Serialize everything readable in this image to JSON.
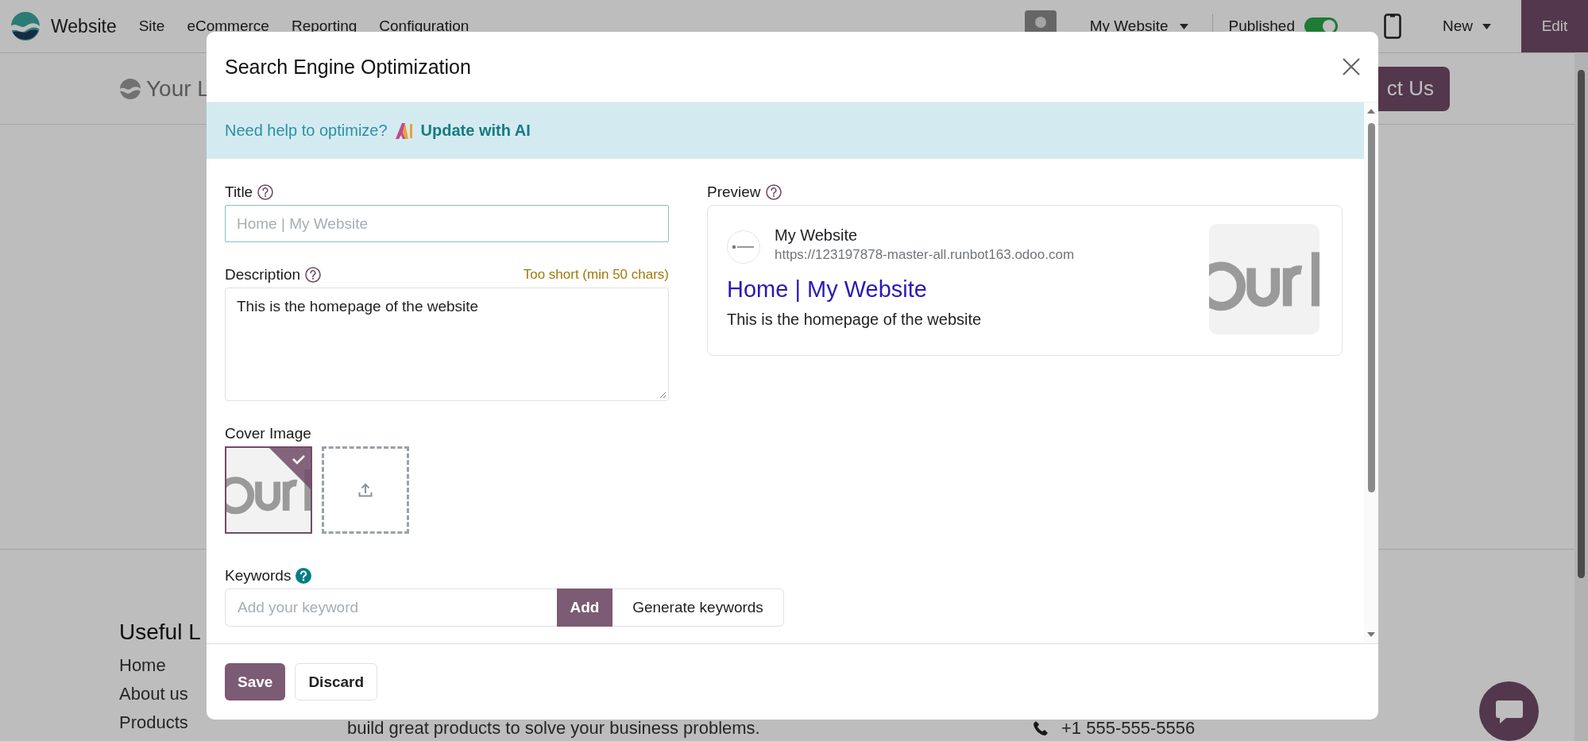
{
  "navbar": {
    "app_name": "Website",
    "menu": [
      "Site",
      "eCommerce",
      "Reporting",
      "Configuration"
    ],
    "website_selector": "My Website",
    "published": {
      "label": "Published",
      "on": true
    },
    "new_button": "New",
    "edit_button": "Edit"
  },
  "page": {
    "header_logo": "Your L",
    "contact_button": "ct Us",
    "footer_heading": "Useful L",
    "footer_links": [
      "Home",
      "About us",
      "Products"
    ],
    "footer_text": "build great products to solve your business problems.",
    "phone": "+1 555-555-5556"
  },
  "dialog": {
    "title": "Search Engine Optimization",
    "banner": {
      "text": "Need help to optimize?",
      "link": "Update with AI"
    },
    "title_field": {
      "label": "Title",
      "placeholder": "Home | My Website"
    },
    "description_field": {
      "label": "Description",
      "warning": "Too short (min 50 chars)",
      "value": "This is the homepage of the website"
    },
    "cover_image": {
      "label": "Cover Image",
      "images": [
        {
          "kind": "picture",
          "selected": true
        },
        {
          "kind": "upload",
          "selected": false
        }
      ]
    },
    "keywords": {
      "label": "Keywords",
      "placeholder": "Add your keyword",
      "add_button": "Add",
      "generate_button": "Generate keywords"
    },
    "preview": {
      "label": "Preview",
      "site_name": "My Website",
      "url": "https://123197878-master-all.runbot163.odoo.com",
      "page_title": "Home | My Website",
      "description": "This is the homepage of the website"
    },
    "buttons": [
      {
        "label": "Save",
        "kind": "primary"
      },
      {
        "label": "Discard",
        "kind": "secondary"
      }
    ]
  }
}
